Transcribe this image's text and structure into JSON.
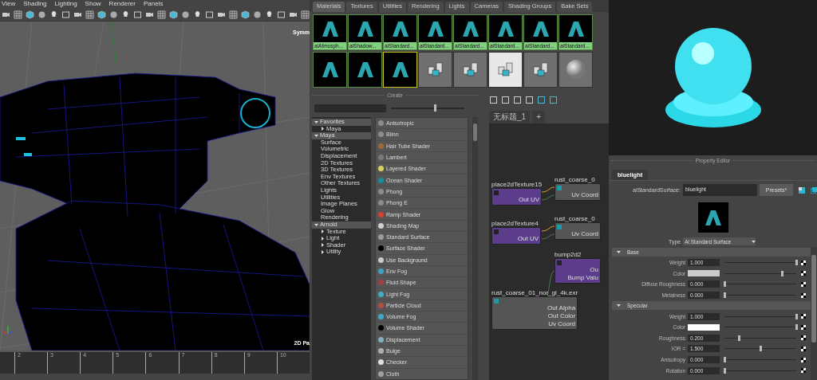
{
  "viewport": {
    "menu": [
      "View",
      "Shading",
      "Lighting",
      "Show",
      "Renderer",
      "Panels"
    ],
    "symmetry_label": "Symm",
    "camera_label": "2D Pa",
    "timeline_ticks": [
      "2",
      "3",
      "4",
      "5",
      "6",
      "7",
      "8",
      "9",
      "10"
    ]
  },
  "hypershade": {
    "tabs": [
      {
        "label": "Materials",
        "selected": true
      },
      {
        "label": "Textures",
        "selected": false
      },
      {
        "label": "Utilities",
        "selected": false
      },
      {
        "label": "Rendering",
        "selected": false
      },
      {
        "label": "Lights",
        "selected": false
      },
      {
        "label": "Cameras",
        "selected": false
      },
      {
        "label": "Shading Groups",
        "selected": false
      },
      {
        "label": "Bake Sets",
        "selected": false
      }
    ],
    "swatches": [
      {
        "kind": "arnold",
        "label": "aiAtmosph...",
        "selected": false,
        "highlighted": false
      },
      {
        "kind": "arnold",
        "label": "aiShadow...",
        "selected": false,
        "highlighted": false
      },
      {
        "kind": "arnold",
        "label": "aiStandard...",
        "selected": false,
        "highlighted": false
      },
      {
        "kind": "arnold",
        "label": "aiStandard...",
        "selected": false,
        "highlighted": false
      },
      {
        "kind": "arnold",
        "label": "aiStandard...",
        "selected": false,
        "highlighted": false
      },
      {
        "kind": "arnold",
        "label": "aiStandard...",
        "selected": false,
        "highlighted": false
      },
      {
        "kind": "arnold",
        "label": "aiStandard...",
        "selected": false,
        "highlighted": false
      },
      {
        "kind": "arnold",
        "label": "aiStandard...",
        "selected": false,
        "highlighted": false
      },
      {
        "kind": "arnold",
        "selected": false,
        "highlighted": false
      },
      {
        "kind": "arnold",
        "selected": false,
        "highlighted": false
      },
      {
        "kind": "arnold",
        "selected": true,
        "highlighted": false
      },
      {
        "kind": "maya",
        "selected": false,
        "highlighted": false
      },
      {
        "kind": "maya",
        "selected": false,
        "highlighted": false
      },
      {
        "kind": "maya",
        "selected": false,
        "highlighted": true
      },
      {
        "kind": "maya",
        "selected": false,
        "highlighted": false
      },
      {
        "kind": "sphere",
        "selected": false,
        "highlighted": false
      }
    ]
  },
  "create": {
    "title": "Create",
    "size_slider": {
      "level": 0.6
    },
    "tree": [
      {
        "label": "Favorites",
        "expanded": true,
        "children": [
          {
            "label": "Maya",
            "expanded": false
          }
        ]
      },
      {
        "label": "Maya",
        "expanded": true,
        "children": [
          {
            "label": "Surface"
          },
          {
            "label": "Volumetric"
          },
          {
            "label": "Displacement"
          },
          {
            "label": "2D Textures"
          },
          {
            "label": "3D Textures"
          },
          {
            "label": "Env Textures"
          },
          {
            "label": "Other Textures"
          },
          {
            "label": "Lights"
          },
          {
            "label": "Utilities"
          },
          {
            "label": "Image Planes"
          },
          {
            "label": "Glow"
          },
          {
            "label": "Rendering"
          }
        ]
      },
      {
        "label": "Arnold",
        "expanded": true,
        "children": [
          {
            "label": "Texture",
            "expanded": false
          },
          {
            "label": "Light",
            "expanded": false
          },
          {
            "label": "Shader",
            "expanded": false
          },
          {
            "label": "Utility",
            "expanded": false
          }
        ]
      }
    ],
    "items": [
      {
        "label": "Anisotropic",
        "color": "#8c8c8c"
      },
      {
        "label": "Blinn",
        "color": "#8c8c8c"
      },
      {
        "label": "Hair Tube Shader",
        "color": "#9a6a3a"
      },
      {
        "label": "Lambert",
        "color": "#7a7a7a"
      },
      {
        "label": "Layered Shader",
        "color": "#d8d060"
      },
      {
        "label": "Ocean Shader",
        "color": "#1a8a9a"
      },
      {
        "label": "Phong",
        "color": "#8c8c8c"
      },
      {
        "label": "Phong E",
        "color": "#8c8c8c"
      },
      {
        "label": "Ramp Shader",
        "color": "#d84030"
      },
      {
        "label": "Shading Map",
        "color": "#d0d0d0"
      },
      {
        "label": "Standard Surface",
        "color": "#9a9a9a"
      },
      {
        "label": "Surface Shader",
        "color": "#000000"
      },
      {
        "label": "Use Background",
        "color": "#c8c8c8"
      },
      {
        "label": "Env Fog",
        "color": "#40a0c0"
      },
      {
        "label": "Fluid Shape",
        "color": "#a04040"
      },
      {
        "label": "Light Fog",
        "color": "#40b0c0"
      },
      {
        "label": "Particle Cloud",
        "color": "#b05040"
      },
      {
        "label": "Volume Fog",
        "color": "#40a8c8"
      },
      {
        "label": "Volume Shader",
        "color": "#000000"
      },
      {
        "label": "Displacement",
        "color": "#80b0c0"
      },
      {
        "label": "Bulge",
        "color": "#b0b0b0"
      },
      {
        "label": "Checker",
        "color": "#e0e0e0"
      },
      {
        "label": "Cloth",
        "color": "#a0a0a0"
      }
    ]
  },
  "node_editor": {
    "tab": "无标题_1",
    "add_tab": "+",
    "nodes": [
      {
        "title": "place2dTexture15",
        "kind": "utility",
        "ports": [
          "Out UV"
        ]
      },
      {
        "title": "rust_coarse_0",
        "kind": "file",
        "ports": [
          "Uv Coord"
        ]
      },
      {
        "title": "place2dTexture4",
        "kind": "utility",
        "ports": [
          "Out UV"
        ]
      },
      {
        "title": "rust_coarse_0",
        "kind": "file",
        "ports": [
          "Uv Coord"
        ]
      },
      {
        "title": "bump2d2",
        "kind": "utility",
        "ports": [
          "Ou",
          "Bump Valu"
        ]
      },
      {
        "title": "rust_coarse_01_nor_gl_4k.exr",
        "kind": "file",
        "ports": [
          "Out Alpha",
          "Out Color",
          "Uv Coord"
        ]
      }
    ]
  },
  "property_editor": {
    "title": "Property Editor",
    "tab": "bluelight",
    "node_type": "aiStandardSurface:",
    "node_name": "bluelight",
    "presets": "Presets*",
    "type_label": "Type",
    "type_value": "Ai Standard Surface",
    "sections": [
      {
        "title": "Base",
        "expanded": true,
        "attributes": [
          {
            "label": "Weight",
            "kind": "number",
            "value": "1.000",
            "level": 1
          },
          {
            "label": "Color",
            "kind": "color",
            "color": "#cccccc",
            "level": 0.8
          },
          {
            "label": "Diffuse Roughness",
            "kind": "number",
            "value": "0.000",
            "level": 0
          },
          {
            "label": "Metalness",
            "kind": "number",
            "value": "0.000",
            "level": 0
          }
        ]
      },
      {
        "title": "Specular",
        "expanded": true,
        "attributes": [
          {
            "label": "Weight",
            "kind": "number",
            "value": "1.000",
            "level": 1
          },
          {
            "label": "Color",
            "kind": "color",
            "color": "#ffffff",
            "level": 1
          },
          {
            "label": "Roughness",
            "kind": "number",
            "value": "0.200",
            "level": 0.2
          },
          {
            "label": "IOR =",
            "kind": "number",
            "value": "1.500",
            "level": 0.5
          },
          {
            "label": "Anisotropy",
            "kind": "number",
            "value": "0.000",
            "level": 0
          },
          {
            "label": "Rotation",
            "kind": "number",
            "value": "0.000",
            "level": 0
          }
        ]
      }
    ]
  }
}
